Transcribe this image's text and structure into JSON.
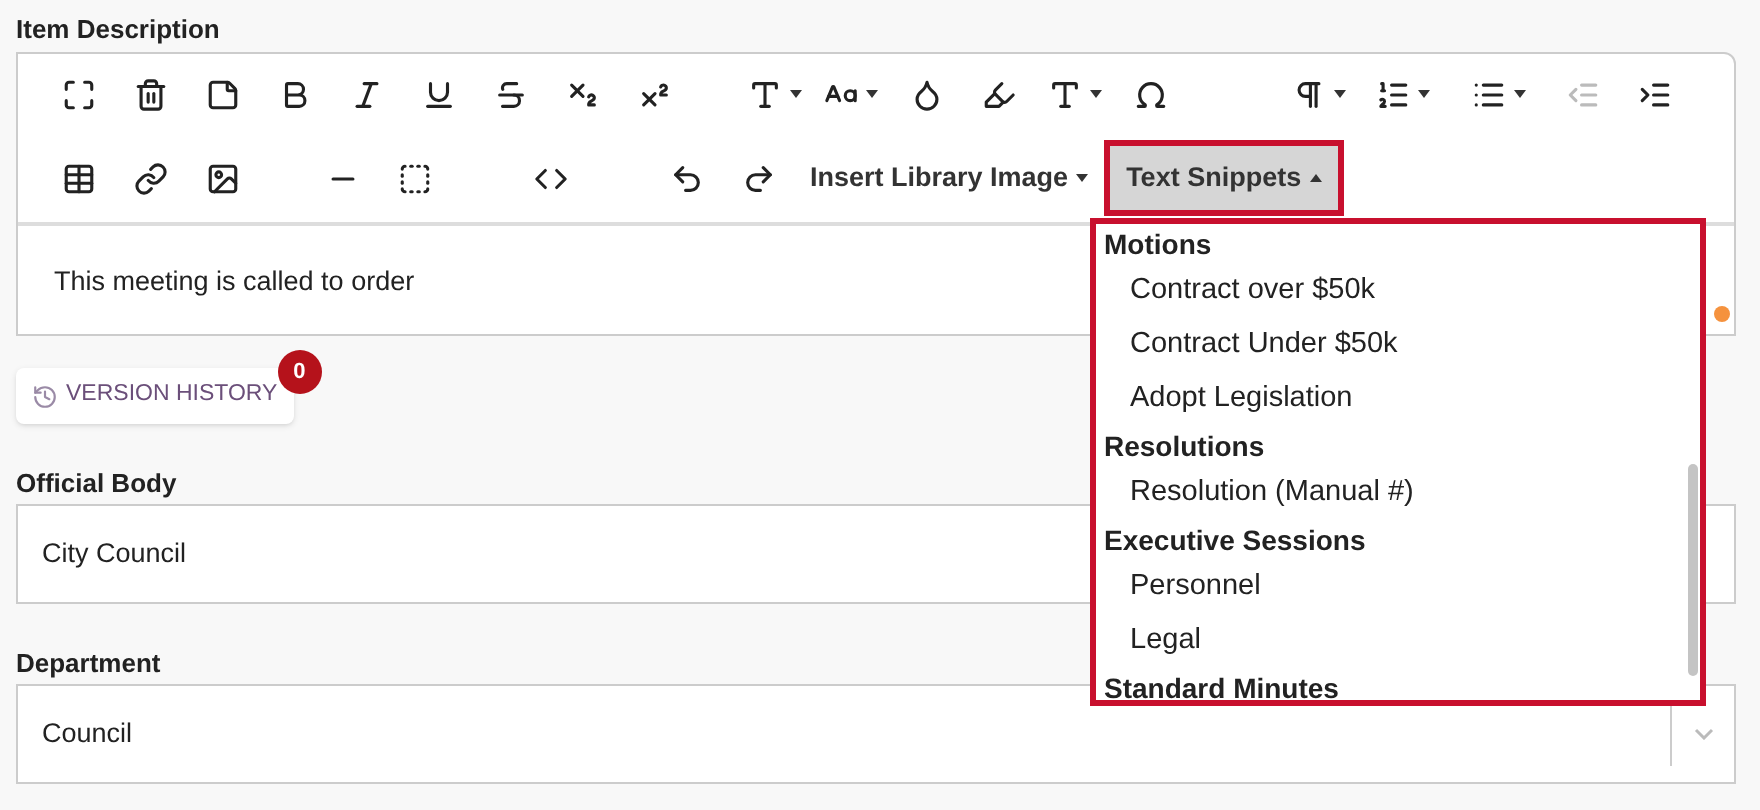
{
  "item_description": {
    "label": "Item Description",
    "toolbar": {
      "insert_library_image": {
        "label": "Insert Library Image"
      },
      "text_snippets": {
        "label": "Text Snippets",
        "expanded": true
      }
    },
    "content": "This meeting is called to order",
    "snippets_menu": [
      {
        "heading": "Motions",
        "items": [
          "Contract over $50k",
          "Contract Under $50k",
          "Adopt Legislation"
        ]
      },
      {
        "heading": "Resolutions",
        "items": [
          "Resolution (Manual #)"
        ]
      },
      {
        "heading": "Executive Sessions",
        "items": [
          "Personnel",
          "Legal"
        ]
      },
      {
        "heading": "Standard Minutes"
      }
    ]
  },
  "version_history": {
    "label": "VERSION HISTORY",
    "count": "0"
  },
  "fields": [
    {
      "label": "Official Body",
      "value": "City Council"
    },
    {
      "label": "Department",
      "value": "Council"
    }
  ]
}
